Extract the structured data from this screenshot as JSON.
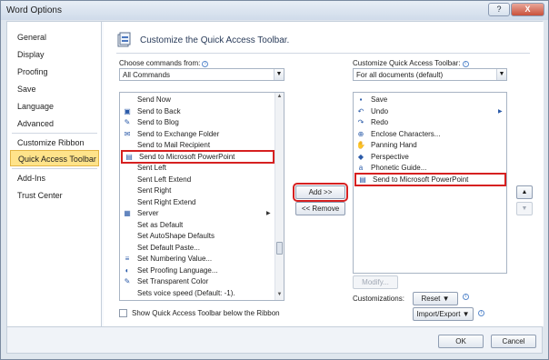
{
  "window": {
    "title": "Word Options",
    "help_label": "?",
    "close_label": "X"
  },
  "nav": [
    {
      "label": "General"
    },
    {
      "label": "Display"
    },
    {
      "label": "Proofing"
    },
    {
      "label": "Save"
    },
    {
      "label": "Language"
    },
    {
      "label": "Advanced"
    },
    {
      "label": "Customize Ribbon"
    },
    {
      "label": "Quick Access Toolbar"
    },
    {
      "label": "Add-Ins"
    },
    {
      "label": "Trust Center"
    }
  ],
  "header": {
    "title": "Customize the Quick Access Toolbar."
  },
  "left": {
    "choose_label": "Choose commands from:",
    "choose_value": "All Commands",
    "commands": [
      {
        "label": "Send Now",
        "icon": "send-now-icon",
        "glyph": ""
      },
      {
        "label": "Send to Back",
        "icon": "send-to-back-icon",
        "glyph": "▣"
      },
      {
        "label": "Send to Blog",
        "icon": "send-to-blog-icon",
        "glyph": "✎"
      },
      {
        "label": "Send to Exchange Folder",
        "icon": "exchange-folder-icon",
        "glyph": "✉"
      },
      {
        "label": "Send to Mail Recipient",
        "icon": "mail-recipient-icon",
        "glyph": ""
      },
      {
        "label": "Send to Microsoft PowerPoint",
        "icon": "powerpoint-icon",
        "glyph": "▤"
      },
      {
        "label": "Sent Left",
        "icon": "",
        "glyph": ""
      },
      {
        "label": "Sent Left Extend",
        "icon": "",
        "glyph": ""
      },
      {
        "label": "Sent Right",
        "icon": "",
        "glyph": ""
      },
      {
        "label": "Sent Right Extend",
        "icon": "",
        "glyph": ""
      },
      {
        "label": "Server",
        "icon": "server-icon",
        "glyph": "▦"
      },
      {
        "label": "Set as Default",
        "icon": "",
        "glyph": ""
      },
      {
        "label": "Set AutoShape Defaults",
        "icon": "",
        "glyph": ""
      },
      {
        "label": "Set Default Paste...",
        "icon": "",
        "glyph": ""
      },
      {
        "label": "Set Numbering Value...",
        "icon": "numbering-icon",
        "glyph": "≡"
      },
      {
        "label": "Set Proofing Language...",
        "icon": "proofing-language-icon",
        "glyph": "◐"
      },
      {
        "label": "Set Transparent Color",
        "icon": "transparent-color-icon",
        "glyph": "✎"
      },
      {
        "label": "Sets voice speed (Default: -1).",
        "icon": "",
        "glyph": ""
      }
    ],
    "server_submenu_glyph": "▶",
    "show_below_label": "Show Quick Access Toolbar below the Ribbon"
  },
  "middle": {
    "add_label": "Add >>",
    "remove_label": "<< Remove"
  },
  "right": {
    "customize_label": "Customize Quick Access Toolbar:",
    "customize_value": "For all documents (default)",
    "items": [
      {
        "label": "Save",
        "icon": "save-icon",
        "glyph": "▪"
      },
      {
        "label": "Undo",
        "icon": "undo-icon",
        "glyph": "↶"
      },
      {
        "label": "Redo",
        "icon": "redo-icon",
        "glyph": "↷"
      },
      {
        "label": "Enclose Characters...",
        "icon": "enclose-characters-icon",
        "glyph": "⊕"
      },
      {
        "label": "Panning Hand",
        "icon": "hand-icon",
        "glyph": "✋"
      },
      {
        "label": "Perspective",
        "icon": "perspective-icon",
        "glyph": "◆"
      },
      {
        "label": "Phonetic Guide...",
        "icon": "phonetic-guide-icon",
        "glyph": "a"
      },
      {
        "label": "Send to Microsoft PowerPoint",
        "icon": "powerpoint-icon",
        "glyph": "▤"
      }
    ],
    "undo_submenu_glyph": "▶",
    "modify_label": "Modify...",
    "customizations_label": "Customizations:",
    "reset_label": "Reset ▼",
    "import_export_label": "Import/Export ▼",
    "move_up_glyph": "▲",
    "move_down_glyph": "▼"
  },
  "footer": {
    "ok_label": "OK",
    "cancel_label": "Cancel"
  }
}
